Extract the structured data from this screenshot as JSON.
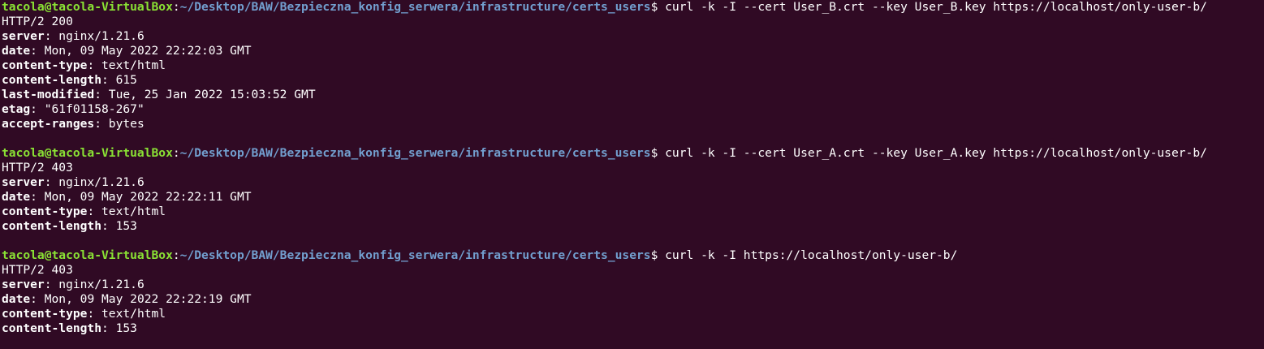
{
  "terminal": {
    "background": "#300a24",
    "prompt_color": "#8ae234",
    "path_color": "#729fcf",
    "blocks": [
      {
        "prompt": {
          "user_host": "tacola@tacola-VirtualBox",
          "colon": ":",
          "path": "~/Desktop/BAW/Bezpieczna_konfig_serwera/infrastructure/certs_users",
          "dollar": "$",
          "command": " curl -k -I --cert User_B.crt --key User_B.key https://localhost/only-user-b/"
        },
        "status": "HTTP/2 200",
        "headers": [
          {
            "key": "server",
            "value": ": nginx/1.21.6"
          },
          {
            "key": "date",
            "value": ": Mon, 09 May 2022 22:22:03 GMT"
          },
          {
            "key": "content-type",
            "value": ": text/html"
          },
          {
            "key": "content-length",
            "value": ": 615"
          },
          {
            "key": "last-modified",
            "value": ": Tue, 25 Jan 2022 15:03:52 GMT"
          },
          {
            "key": "etag",
            "value": ": \"61f01158-267\""
          },
          {
            "key": "accept-ranges",
            "value": ": bytes"
          }
        ]
      },
      {
        "prompt": {
          "user_host": "tacola@tacola-VirtualBox",
          "colon": ":",
          "path": "~/Desktop/BAW/Bezpieczna_konfig_serwera/infrastructure/certs_users",
          "dollar": "$",
          "command": " curl -k -I --cert User_A.crt --key User_A.key https://localhost/only-user-b/"
        },
        "status": "HTTP/2 403",
        "headers": [
          {
            "key": "server",
            "value": ": nginx/1.21.6"
          },
          {
            "key": "date",
            "value": ": Mon, 09 May 2022 22:22:11 GMT"
          },
          {
            "key": "content-type",
            "value": ": text/html"
          },
          {
            "key": "content-length",
            "value": ": 153"
          }
        ]
      },
      {
        "prompt": {
          "user_host": "tacola@tacola-VirtualBox",
          "colon": ":",
          "path": "~/Desktop/BAW/Bezpieczna_konfig_serwera/infrastructure/certs_users",
          "dollar": "$",
          "command": " curl -k -I https://localhost/only-user-b/"
        },
        "status": "HTTP/2 403",
        "headers": [
          {
            "key": "server",
            "value": ": nginx/1.21.6"
          },
          {
            "key": "date",
            "value": ": Mon, 09 May 2022 22:22:19 GMT"
          },
          {
            "key": "content-type",
            "value": ": text/html"
          },
          {
            "key": "content-length",
            "value": ": 153"
          }
        ]
      }
    ]
  }
}
